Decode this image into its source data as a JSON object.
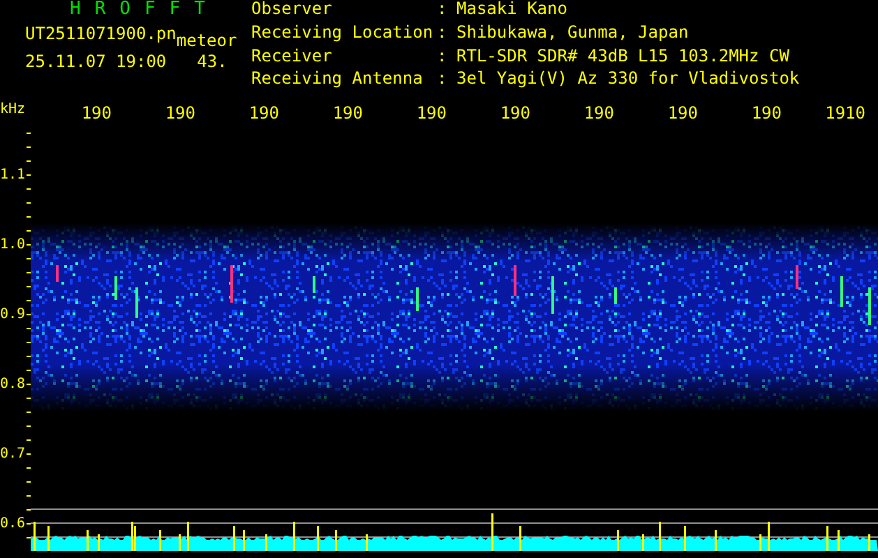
{
  "app_title": "HROFFT",
  "file": {
    "name": "UT2511071900.pn",
    "mode": "meteor",
    "date_time": "25.11.07 19:00",
    "value": "43."
  },
  "station_info": {
    "separator": ":",
    "rows": [
      {
        "label": "Observer",
        "value": "Masaki Kano"
      },
      {
        "label": "Receiving Location",
        "value": "Shibukawa, Gunma, Japan"
      },
      {
        "label": "Receiver",
        "value": "RTL-SDR SDR# 43dB L15 103.2MHz CW"
      },
      {
        "label": "Receiving Antenna",
        "value": "3el Yagi(V) Az 330 for Vladivostok"
      }
    ]
  },
  "frequency_axis": {
    "unit": "kHz",
    "labels": [
      "190",
      "190",
      "190",
      "190",
      "190",
      "190",
      "190",
      "190",
      "190",
      "1910"
    ]
  },
  "level_axis": {
    "labels": [
      "1.1",
      "1.0",
      "0.9",
      "0.8",
      "0.7",
      "0.6"
    ]
  }
}
